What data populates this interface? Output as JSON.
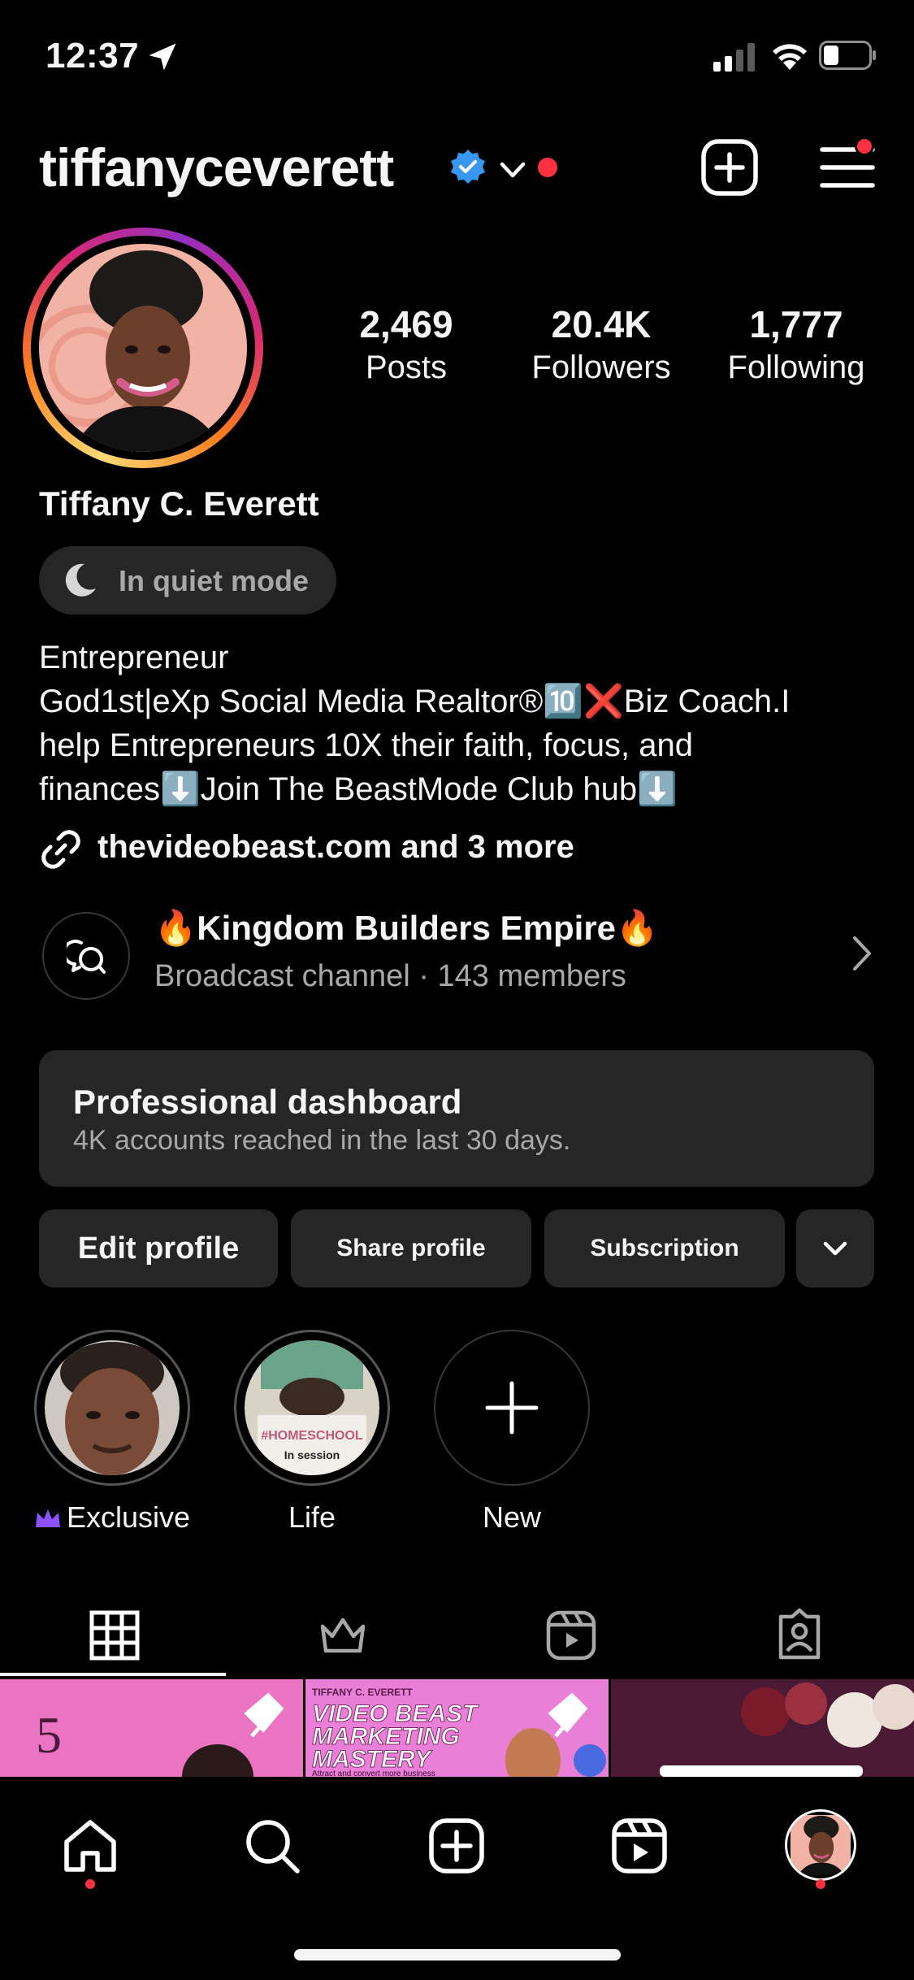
{
  "status_bar": {
    "time": "12:37"
  },
  "header": {
    "username": "tiffanyceverett",
    "verified_icon": "verified-badge-icon"
  },
  "profile": {
    "stats": [
      {
        "value": "2,469",
        "label": "Posts"
      },
      {
        "value": "20.4K",
        "label": "Followers"
      },
      {
        "value": "1,777",
        "label": "Following"
      }
    ],
    "display_name": "Tiffany C. Everett",
    "quiet_mode": "In quiet mode",
    "bio": [
      "Entrepreneur",
      "God1st|eXp Social Media Realtor®🔟❌Biz Coach.I",
      "help Entrepreneurs 10X their faith, focus, and",
      "finances⬇️Join The BeastMode Club hub⬇️"
    ],
    "link": "thevideobeast.com and 3 more"
  },
  "channel": {
    "name": "🔥Kingdom Builders Empire🔥",
    "subtitle": "Broadcast channel · 143 members"
  },
  "dashboard": {
    "title": "Professional dashboard",
    "subtitle": "4K accounts reached in the last 30 days."
  },
  "actions": {
    "edit": "Edit profile",
    "share": "Share profile",
    "subscription": "Subscription"
  },
  "highlights": [
    {
      "label": "Exclusive"
    },
    {
      "label": "Life",
      "overlay_line1": "#HOMESCHOOL",
      "overlay_line2": "In session"
    },
    {
      "label": "New"
    }
  ],
  "grid": {
    "tile1_number": "5",
    "tile2_line1": "TIFFANY C. EVERETT",
    "tile2_line2": "VIDEO BEAST",
    "tile2_line3": "MARKETING",
    "tile2_line4": "MASTERY",
    "tile2_line5": "Attract and convert more business"
  },
  "colors": {
    "background": "#000000",
    "surface": "#262626",
    "notification": "#ff3040",
    "verified": "#3897f0",
    "subscriber_crown": "#8c52ff"
  }
}
